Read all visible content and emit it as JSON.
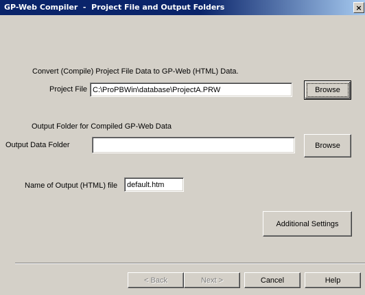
{
  "window": {
    "title": "GP-Web Compiler  -  Project File and Output Folders",
    "close_label": "×"
  },
  "convert_section": {
    "heading": "Convert (Compile) Project File Data to GP-Web (HTML) Data.",
    "project_file_label": "Project File",
    "project_file_value": "C:\\ProPBWin\\database\\ProjectA.PRW",
    "browse_label": "Browse"
  },
  "output_section": {
    "heading": "Output Folder for Compiled GP-Web Data",
    "output_folder_label": "Output Data Folder",
    "output_folder_value": "",
    "browse_label": "Browse"
  },
  "output_file": {
    "label": "Name of Output (HTML) file",
    "value": "default.htm"
  },
  "additional_settings_label": "Additional Settings",
  "footer": {
    "back_label": "< Back",
    "next_label": "Next >",
    "cancel_label": "Cancel",
    "help_label": "Help"
  },
  "colors": {
    "title_active": "#0a246a",
    "face": "#d4d0c8"
  }
}
